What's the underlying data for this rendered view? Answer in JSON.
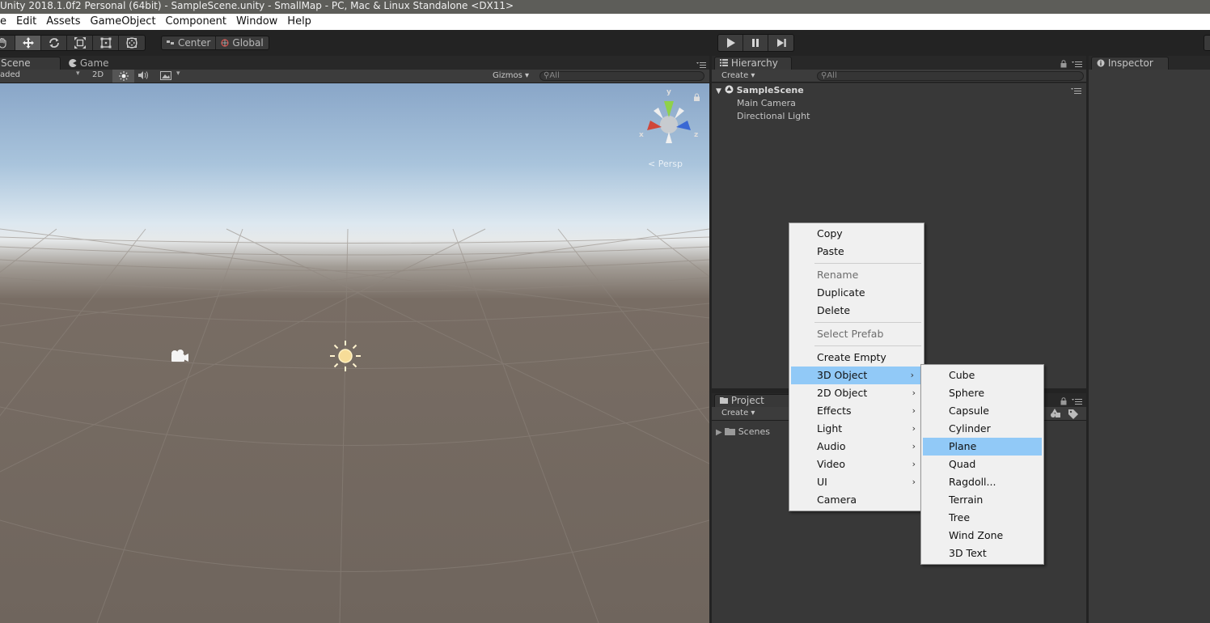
{
  "window": {
    "title": "Unity 2018.1.0f2 Personal (64bit) - SampleScene.unity - SmallMap - PC, Mac & Linux Standalone <DX11>"
  },
  "menubar": {
    "items": [
      "e",
      "Edit",
      "Assets",
      "GameObject",
      "Component",
      "Window",
      "Help"
    ]
  },
  "toolbar": {
    "tools": [
      "hand-tool-icon",
      "move-tool-icon",
      "rotate-tool-icon",
      "scale-tool-icon",
      "rect-tool-icon",
      "transform-tool-icon"
    ],
    "active_tool": "move",
    "pivot_label": "Center",
    "space_label": "Global",
    "play_icons": [
      "play-icon",
      "pause-icon",
      "step-icon"
    ]
  },
  "scene_panel": {
    "tabs": [
      "Scene",
      "Game"
    ],
    "shading_label": "aded",
    "mode_2d_label": "2D",
    "gizmos_label": "Gizmos",
    "search_placeholder": "All",
    "persp_label": "< Persp",
    "axis_labels": {
      "x": "x",
      "y": "y",
      "z": "z"
    }
  },
  "hierarchy": {
    "tab_label": "Hierarchy",
    "create_label": "Create",
    "search_placeholder": "All",
    "scene_name": "SampleScene",
    "items": [
      "Main Camera",
      "Directional Light"
    ]
  },
  "project": {
    "tab_label": "Project",
    "create_label": "Create",
    "folders": [
      "Scenes"
    ]
  },
  "inspector": {
    "tab_label": "Inspector"
  },
  "context_menu": {
    "items": [
      {
        "label": "Copy",
        "enabled": true
      },
      {
        "label": "Paste",
        "enabled": true
      },
      {
        "label": "Rename",
        "enabled": false
      },
      {
        "label": "Duplicate",
        "enabled": true
      },
      {
        "label": "Delete",
        "enabled": true
      },
      {
        "label": "Select Prefab",
        "enabled": false
      },
      {
        "label": "Create Empty",
        "enabled": true
      },
      {
        "label": "3D Object",
        "enabled": true,
        "submenu": true,
        "selected": true
      },
      {
        "label": "2D Object",
        "enabled": true,
        "submenu": true
      },
      {
        "label": "Effects",
        "enabled": true,
        "submenu": true
      },
      {
        "label": "Light",
        "enabled": true,
        "submenu": true
      },
      {
        "label": "Audio",
        "enabled": true,
        "submenu": true
      },
      {
        "label": "Video",
        "enabled": true,
        "submenu": true
      },
      {
        "label": "UI",
        "enabled": true,
        "submenu": true
      },
      {
        "label": "Camera",
        "enabled": true
      }
    ]
  },
  "submenu_3d": {
    "items": [
      "Cube",
      "Sphere",
      "Capsule",
      "Cylinder",
      "Plane",
      "Quad",
      "Ragdoll...",
      "Terrain",
      "Tree",
      "Wind Zone",
      "3D Text"
    ],
    "highlighted": "Plane"
  },
  "colors": {
    "selection": "#91c9f7",
    "panel": "#383838",
    "toolbar": "#232323"
  }
}
